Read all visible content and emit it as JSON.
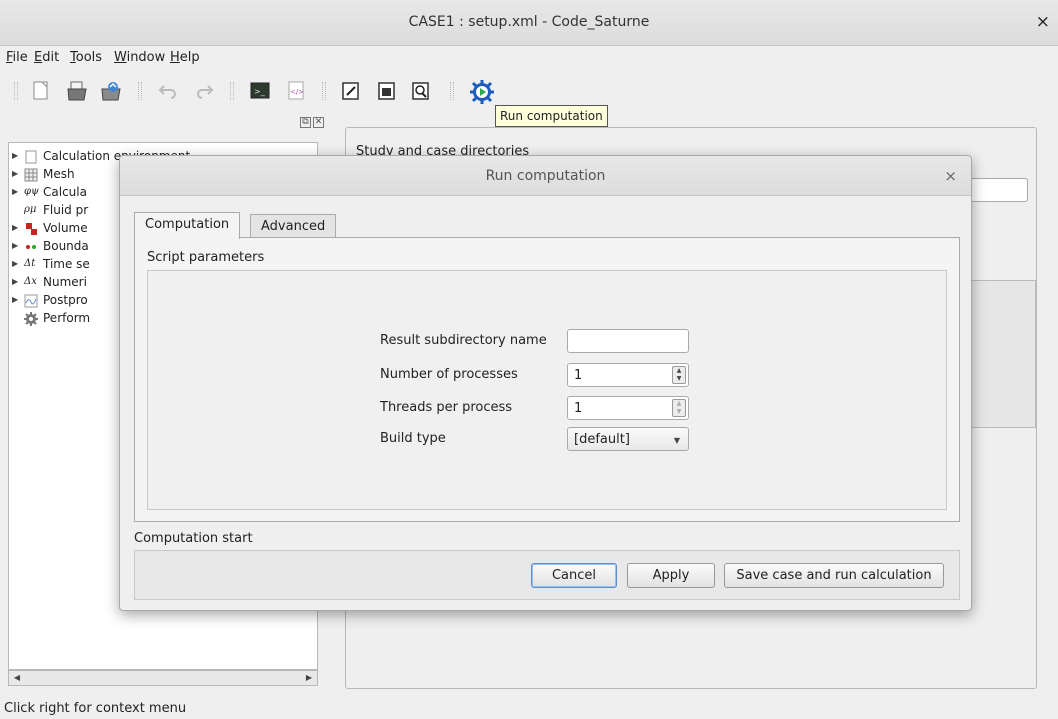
{
  "window": {
    "title": "CASE1 : setup.xml - Code_Saturne",
    "close": "×"
  },
  "menu": {
    "file": "File",
    "edit": "Edit",
    "tools": "Tools",
    "window": "Window",
    "help": "Help"
  },
  "tooltip": "Run computation",
  "tree": {
    "items": [
      {
        "label": "Calculation environment"
      },
      {
        "label": "Mesh"
      },
      {
        "label": "Calcula"
      },
      {
        "label": "Fluid pr"
      },
      {
        "label": "Volume"
      },
      {
        "label": "Bounda"
      },
      {
        "label": "Time se"
      },
      {
        "label": "Numeri"
      },
      {
        "label": "Postpro"
      },
      {
        "label": "Perform"
      }
    ]
  },
  "right_panel": {
    "title": "Study and case directories"
  },
  "status": "Click right for context menu",
  "dialog": {
    "title": "Run computation",
    "close": "×",
    "tabs": {
      "computation": "Computation",
      "advanced": "Advanced"
    },
    "script_parameters": "Script parameters",
    "fields": {
      "result_subdir_label": "Result subdirectory name",
      "result_subdir_value": "",
      "nproc_label": "Number of processes",
      "nproc_value": "1",
      "threads_label": "Threads per process",
      "threads_value": "1",
      "build_type_label": "Build type",
      "build_type_value": "[default]"
    },
    "computation_start": "Computation start",
    "buttons": {
      "cancel": "Cancel",
      "apply": "Apply",
      "save_run": "Save case and run calculation"
    }
  },
  "colors": {
    "tooltip_bg": "#ffffdc",
    "run_icon": "#1e5bbf",
    "focus": "#5b8fd0"
  }
}
